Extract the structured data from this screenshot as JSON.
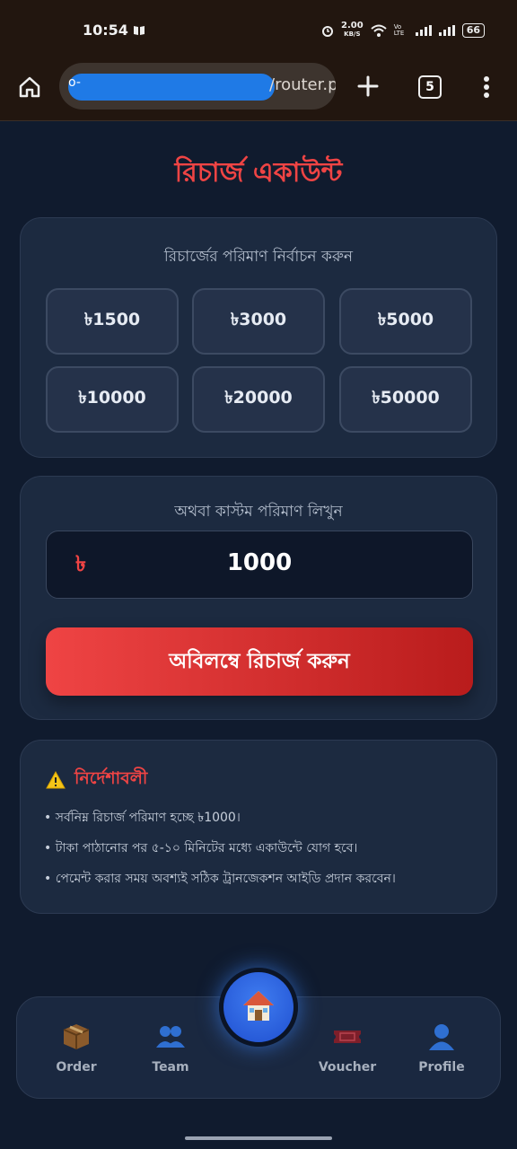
{
  "status_bar": {
    "time": "10:54",
    "speed_value": "2.00",
    "speed_unit": "KB/S",
    "network_label": "Vo LTE",
    "battery": "66",
    "icons": [
      "book-icon",
      "alarm-icon",
      "wifi-icon",
      "signal-icon",
      "signal-icon",
      "battery-icon"
    ]
  },
  "browser": {
    "url_visible": "/router.php?pag",
    "tab_count": "5",
    "icons": [
      "home-icon",
      "plus-icon",
      "tabs-icon",
      "more-vertical-icon"
    ]
  },
  "page": {
    "title": "রিচার্জ একাউন্ট",
    "amount_section_label": "রিচার্জের পরিমাণ নির্বাচন করুন",
    "amounts": [
      "৳1500",
      "৳3000",
      "৳5000",
      "৳10000",
      "৳20000",
      "৳50000"
    ],
    "custom_label": "অথবা কাস্টম পরিমাণ লিখুন",
    "currency_symbol": "৳",
    "custom_amount": "1000",
    "recharge_button": "অবিলম্বে রিচার্জ করুন",
    "notes_title": "নির্দেশাবলী",
    "notes": [
      "• সর্বনিম্ন রিচার্জ পরিমাণ হচ্ছে ৳1000।",
      "• টাকা পাঠানোর পর ৫-১০ মিনিটের মধ্যে একাউন্টে যোগ হবে।",
      "• পেমেন্ট করার সময় অবশ্যই সঠিক ট্রানজেকশন আইডি প্রদান করবেন।"
    ]
  },
  "bottom_nav": {
    "items": [
      {
        "label": "Order",
        "icon": "package-icon"
      },
      {
        "label": "Team",
        "icon": "team-icon"
      },
      {
        "label": "Voucher",
        "icon": "ticket-icon"
      },
      {
        "label": "Profile",
        "icon": "profile-icon"
      }
    ],
    "center_icon": "house-icon"
  },
  "colors": {
    "accent": "#ef4444",
    "background": "#101b2e",
    "card": "#1c2a40",
    "fab": "#2f6df0"
  }
}
